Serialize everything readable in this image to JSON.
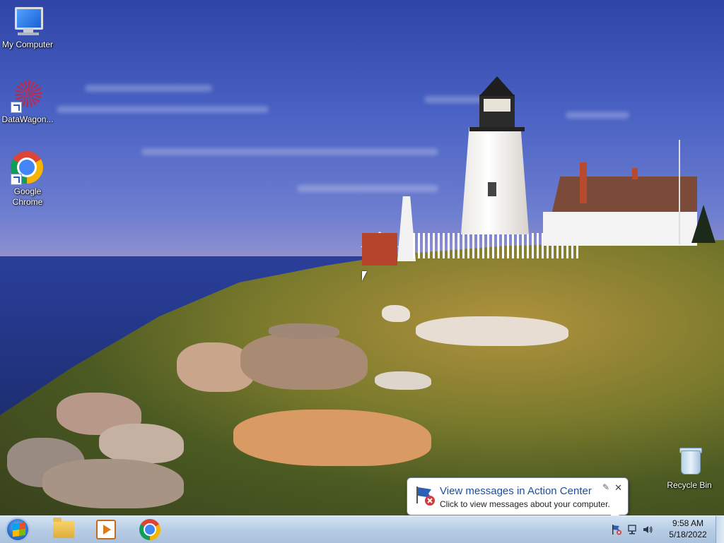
{
  "desktop": {
    "icons": [
      {
        "label": "My Computer",
        "icon": "computer-icon"
      },
      {
        "label": "DataWagon...",
        "icon": "datawagon-icon"
      },
      {
        "label": "Google Chrome",
        "icon": "chrome-icon"
      },
      {
        "label": "Recycle Bin",
        "icon": "recycle-bin-icon"
      }
    ]
  },
  "notification": {
    "title": "View messages in Action Center",
    "subtitle": "Click to view messages about your computer.",
    "close": "✕",
    "pin": "✎"
  },
  "taskbar": {
    "start": "start-button",
    "pinned": [
      "file-explorer-icon",
      "media-player-icon",
      "chrome-icon"
    ],
    "tray": [
      "action-center-flag-icon",
      "network-icon",
      "volume-icon"
    ],
    "clock": {
      "time": "9:58 AM",
      "date": "5/18/2022"
    }
  },
  "colors": {
    "taskbar": "#b7cde4",
    "balloon_title": "#1a4f9c",
    "desktop_text": "#ffffff"
  }
}
